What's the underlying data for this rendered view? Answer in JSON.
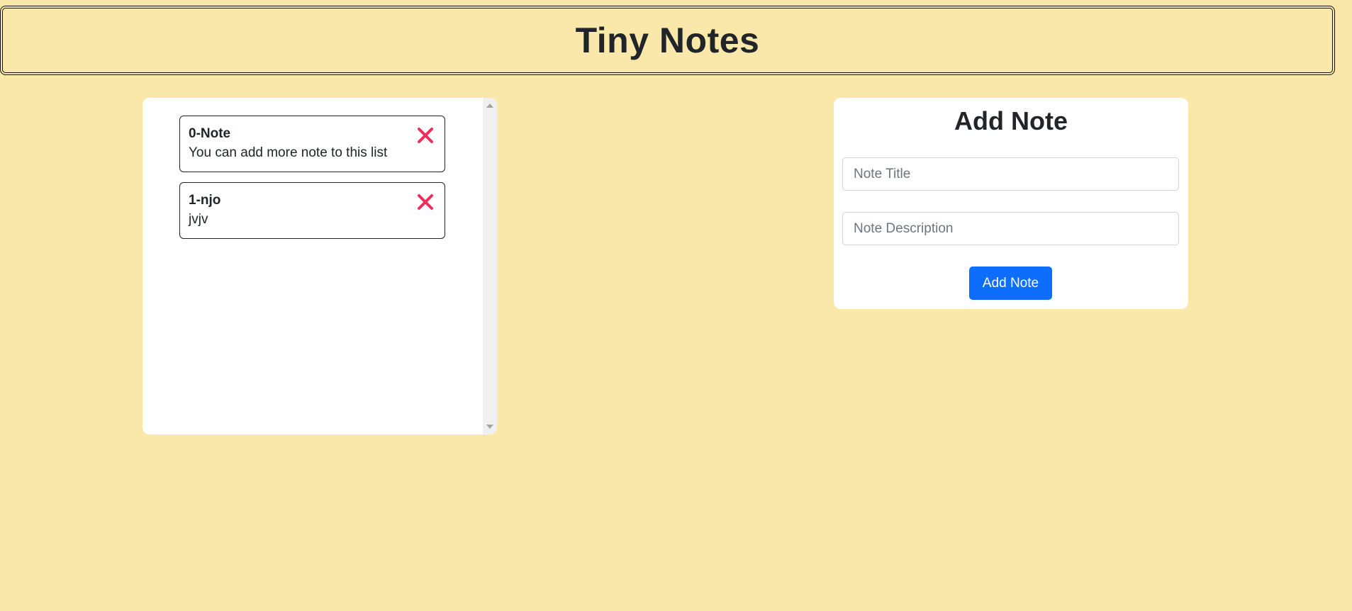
{
  "app": {
    "title": "Tiny Notes"
  },
  "notes": [
    {
      "title": "0-Note",
      "description": "You can add more note to this list"
    },
    {
      "title": "1-njo",
      "description": "jvjv"
    }
  ],
  "add_form": {
    "heading": "Add Note",
    "title_placeholder": "Note Title",
    "title_value": "",
    "description_placeholder": "Note Description",
    "description_value": "",
    "button_label": "Add Note"
  },
  "colors": {
    "page_background": "#f9e8a9",
    "delete_icon": "#ee2d5a",
    "primary_button": "#0d6efd"
  },
  "icons": {
    "delete": "close-icon"
  }
}
